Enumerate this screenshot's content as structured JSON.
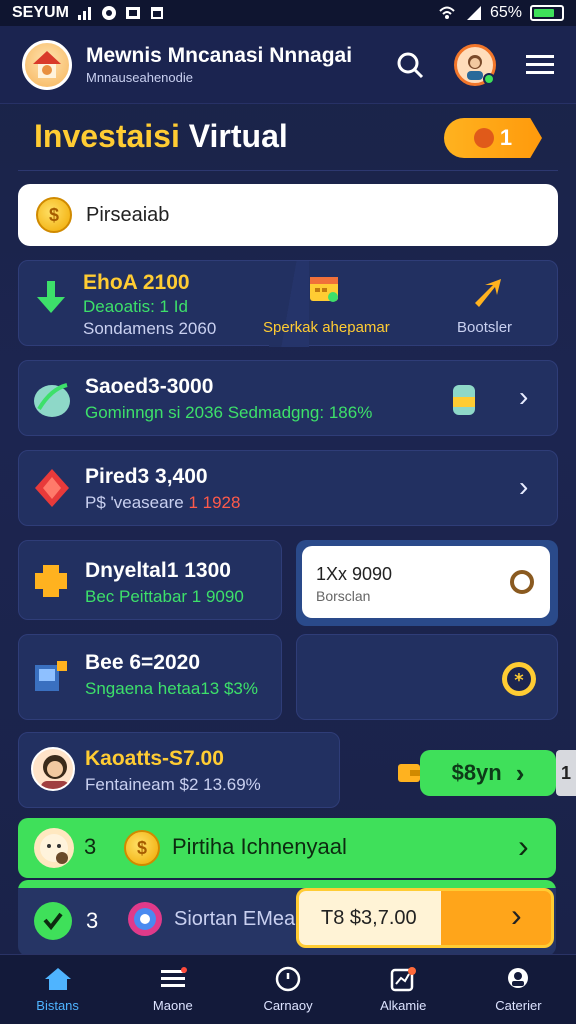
{
  "status": {
    "carrier": "SEYUM",
    "battery": "65%"
  },
  "header": {
    "title": "Mewnis Mncanasi Nnnagai",
    "subtitle": "Mnnauseahenodie"
  },
  "page": {
    "title_word1": "Investaisi",
    "title_word2": "Virtual",
    "badge_value": "1"
  },
  "search": {
    "text": "Pirseaiab"
  },
  "summary": {
    "left_title": "EhoA 2100",
    "left_line2": "Deaoatis: 1 Id",
    "left_line3": "Sondamens 2060",
    "mid_label": "Sperkak ahepamar",
    "right_label": "Bootsler"
  },
  "items": [
    {
      "title": "Saoed3-3000",
      "subtitle": "Gominngn si 2036 Sedmadgng: 186%"
    },
    {
      "title": "Pired3 3,400",
      "subtitle_prefix": "P$ 'veaseare",
      "subtitle_value": "1 1928"
    },
    {
      "title": "Dnyeltal1 1300",
      "subtitle": "Bec Peittabar 1 9090"
    },
    {
      "title": "1Xx 9090",
      "subtitle": "Borsclan"
    },
    {
      "title": "Bee 6=2020",
      "subtitle": "Sngaena hetaa13 $3%"
    },
    {
      "title": "Kaoatts-S7.00",
      "subtitle": "Fentaineam $2 13.69%"
    }
  ],
  "cta": {
    "label": "$8yn",
    "side_value": "1"
  },
  "banner1": {
    "count": "3",
    "text": "Pirtiha Ichnenyaal"
  },
  "banner2": {
    "count": "3",
    "text": "Siortan EMeain",
    "value": "T8 $3,7.00"
  },
  "nav": [
    {
      "label": "Bistans",
      "icon": "home-icon"
    },
    {
      "label": "Maone",
      "icon": "list-icon"
    },
    {
      "label": "Carnaoy",
      "icon": "clock-icon"
    },
    {
      "label": "Alkamie",
      "icon": "chart-icon"
    },
    {
      "label": "Caterier",
      "icon": "profile-icon"
    }
  ],
  "colors": {
    "accent": "#ffcc33",
    "positive": "#3de06a",
    "negative": "#ff5a4a",
    "cta": "#3fe05a",
    "active_nav": "#4fb4ff"
  }
}
